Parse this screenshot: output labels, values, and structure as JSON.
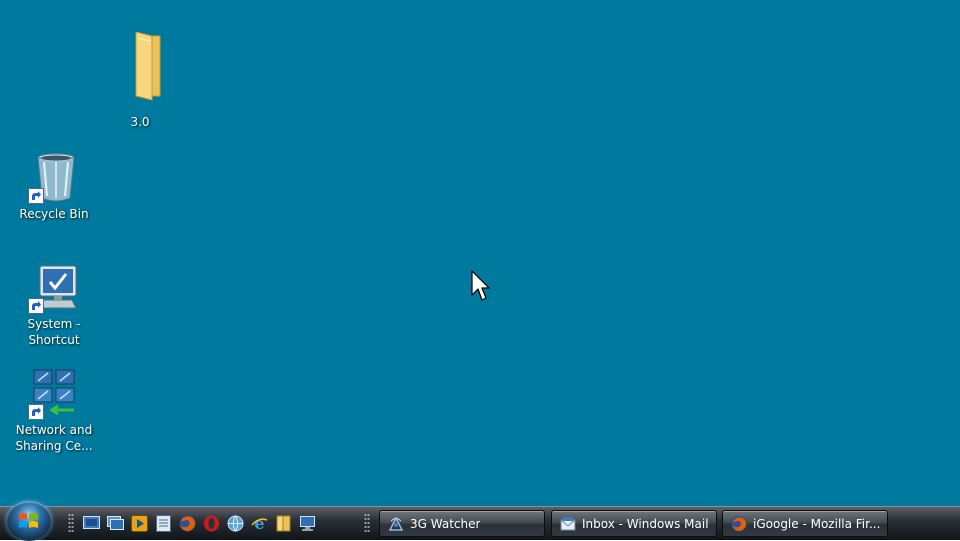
{
  "desktop": {
    "background": "#00799f",
    "icons": [
      {
        "label": "3.0",
        "icon": "folder-icon"
      },
      {
        "label": "Recycle Bin",
        "icon": "recycle-bin-icon"
      },
      {
        "label": "System -\nShortcut",
        "icon": "system-icon"
      },
      {
        "label": "Network and\nSharing Ce...",
        "icon": "network-sharing-icon"
      }
    ]
  },
  "taskbar": {
    "start_icon": "windows-logo-icon",
    "quick_launch": [
      {
        "name": "show-desktop-icon"
      },
      {
        "name": "switch-windows-icon"
      },
      {
        "name": "media-player-icon"
      },
      {
        "name": "notepad-icon"
      },
      {
        "name": "firefox-icon"
      },
      {
        "name": "opera-icon"
      },
      {
        "name": "browser-globe-icon"
      },
      {
        "name": "internet-explorer-icon"
      },
      {
        "name": "folder-icon"
      },
      {
        "name": "computer-icon"
      }
    ],
    "tasks": [
      {
        "label": "3G Watcher",
        "icon": "3g-watcher-icon"
      },
      {
        "label": "Inbox - Windows Mail",
        "icon": "windows-mail-icon"
      },
      {
        "label": "iGoogle - Mozilla Fir...",
        "icon": "firefox-icon"
      }
    ]
  }
}
